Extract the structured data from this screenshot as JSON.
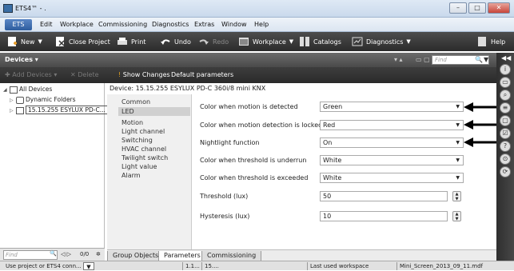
{
  "window": {
    "title": "ETS4™ - .",
    "minimize": "–",
    "maximize": "□",
    "close": "✕"
  },
  "menu": {
    "items": [
      "ETS",
      "Edit",
      "Workplace",
      "Commissioning",
      "Diagnostics",
      "Extras",
      "Window",
      "Help"
    ]
  },
  "toolbar": {
    "new": "New",
    "close_project": "Close Project",
    "print": "Print",
    "undo": "Undo",
    "redo": "Redo",
    "workplace": "Workplace",
    "catalogs": "Catalogs",
    "diagnostics": "Diagnostics",
    "help": "Help"
  },
  "devices_panel": {
    "title": "Devices",
    "add_devices": "Add Devices",
    "delete": "Delete",
    "show_changes": "Show Changes",
    "default_parameters": "Default parameters",
    "search_placeholder": "Find"
  },
  "tree": {
    "items": [
      {
        "label": "All Devices"
      },
      {
        "label": "Dynamic Folders"
      },
      {
        "label": "15.15.255  ESYLUX PD-C..."
      }
    ],
    "find_placeholder": "Find",
    "count": "0/0"
  },
  "device_title": "Device: 15.15.255  ESYLUX PD-C 360i/8 mini KNX",
  "param_nav": [
    "Common",
    "LED",
    "Motion",
    "Light channel",
    "Switching",
    "HVAC channel",
    "Twilight switch",
    "Light value",
    "Alarm"
  ],
  "params": [
    {
      "label": "Color when motion is detected",
      "value": "Green",
      "type": "select"
    },
    {
      "label": "Color when motion detection is locked",
      "value": "Red",
      "type": "select"
    },
    {
      "label": "Nightlight function",
      "value": "On",
      "type": "select"
    },
    {
      "label": "Color when threshold is underrun",
      "value": "White",
      "type": "select"
    },
    {
      "label": "Color when threshold is exceeded",
      "value": "White",
      "type": "select"
    },
    {
      "label": "Threshold (lux)",
      "value": "50",
      "type": "number"
    },
    {
      "label": "Hysteresis (lux)",
      "value": "10",
      "type": "number"
    }
  ],
  "tabs": [
    "Group Objects",
    "Parameters",
    "Commissioning"
  ],
  "status": {
    "project": "Use project or ETS4 conn...",
    "addr1": "1.1...",
    "addr2": "15....",
    "workspace_label": "Last used workspace",
    "workspace_file": "Mini_Screen_2013_09_11.mdf"
  },
  "colors": {
    "toolbar": "#333333",
    "accent": "#2d5d9e"
  }
}
